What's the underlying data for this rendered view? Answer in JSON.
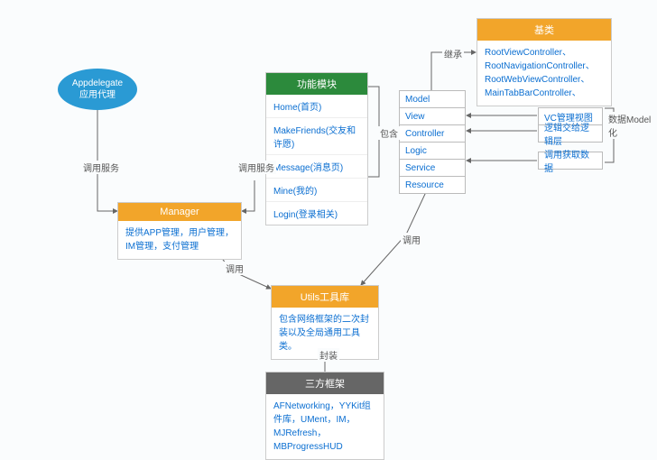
{
  "appdelegate": {
    "line1": "Appdelegate",
    "line2": "应用代理"
  },
  "funcModule": {
    "title": "功能模块",
    "items": [
      "Home(首页)",
      "MakeFriends(交友和许愿)",
      "Message(消息页)",
      "Mine(我的)",
      "Login(登录相关)"
    ]
  },
  "baseClass": {
    "title": "基类",
    "body": "RootViewController、RootNavigationController、RootWebViewController、MainTabBarController、"
  },
  "mvc": {
    "items": [
      "Model",
      "View",
      "Controller",
      "Logic",
      "Service",
      "Resource"
    ]
  },
  "manager": {
    "title": "Manager",
    "body": "提供APP管理，用户管理，IM管理，支付管理"
  },
  "utils": {
    "title": "Utils工具库",
    "body": "包含网络框架的二次封装以及全局通用工具类。"
  },
  "thirdParty": {
    "title": "三方框架",
    "body": "AFNetworking，YYKit组件库，UMent，IM，MJRefresh，MBProgressHUD"
  },
  "annotations": {
    "vcView": "VC管理视图",
    "logicLayer": "逻辑交给逻辑层",
    "fetchData": "调用获取数据",
    "dataModel": "数据Model化"
  },
  "edgeLabels": {
    "callService1": "调用服务",
    "callService2": "调用服务",
    "contain": "包含",
    "inherit": "继承",
    "call1": "调用",
    "call2": "调用",
    "wrap": "封装"
  }
}
